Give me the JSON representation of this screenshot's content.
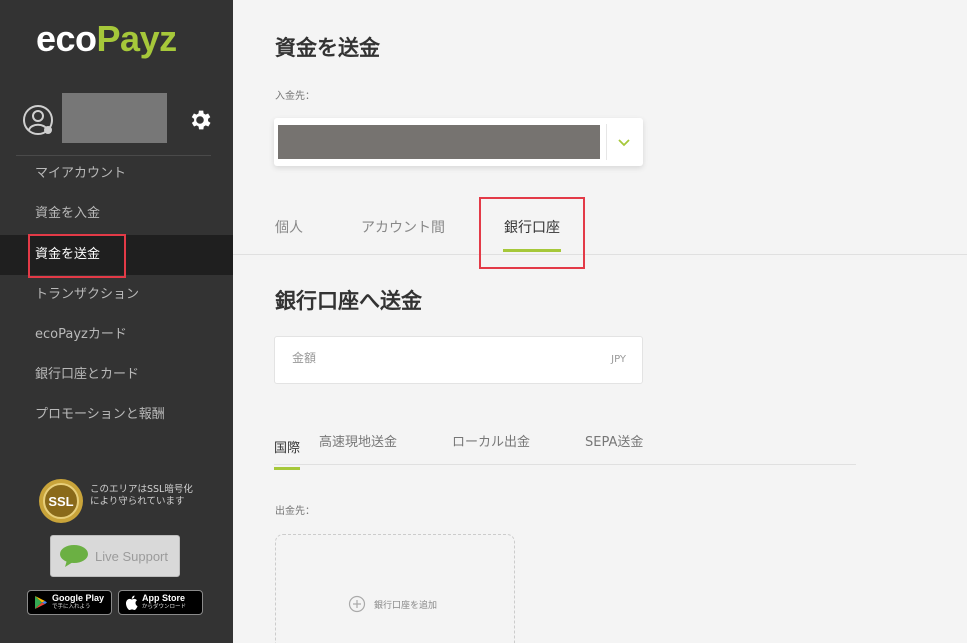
{
  "brand": {
    "logo_eco": "eco",
    "logo_payz": "Payz",
    "accent": "#a6c83a",
    "highlight": "#e33a47"
  },
  "sidebar": {
    "items": [
      {
        "label": "マイアカウント",
        "active": false
      },
      {
        "label": "資金を入金",
        "active": false
      },
      {
        "label": "資金を送金",
        "active": true
      },
      {
        "label": "トランザクション",
        "active": false
      },
      {
        "label": "ecoPayzカード",
        "active": false
      },
      {
        "label": "銀行口座とカード",
        "active": false
      },
      {
        "label": "プロモーションと報酬",
        "active": false
      }
    ],
    "ssl_badge_text": "SSL",
    "ssl_text": "このエリアはSSL暗号化により守られています",
    "live_support": "Live Support",
    "google_play": {
      "name": "Google Play",
      "sub": "で手に入れよう"
    },
    "app_store": {
      "name": "App Store",
      "sub": "からダウンロード"
    }
  },
  "main": {
    "title": "資金を送金",
    "to_label": "入金先：",
    "tabs": [
      {
        "label": "個人",
        "active": false
      },
      {
        "label": "アカウント間",
        "active": false
      },
      {
        "label": "銀行口座",
        "active": true
      }
    ],
    "section_title": "銀行口座へ送金",
    "amount": {
      "placeholder": "金額",
      "currency": "JPY",
      "value": ""
    },
    "subtabs": [
      {
        "label": "国際",
        "active": true
      },
      {
        "label": "高速現地送金",
        "active": false
      },
      {
        "label": "ローカル出金",
        "active": false
      },
      {
        "label": "SEPA送金",
        "active": false
      }
    ],
    "from_label": "出金先：",
    "add_bank": "銀行口座を追加"
  }
}
